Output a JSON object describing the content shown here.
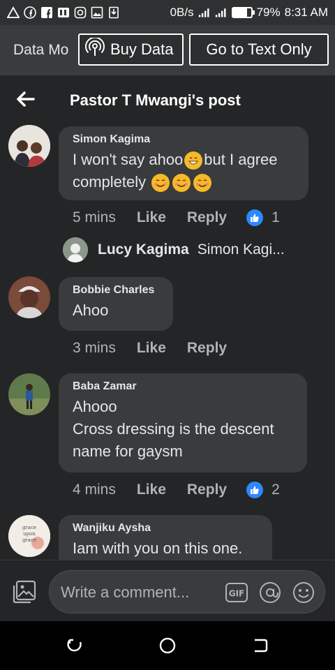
{
  "status_bar": {
    "speed": "0B/s",
    "battery": "79%",
    "battery_level": 0.79,
    "time": "8:31 AM"
  },
  "data_bar": {
    "mode_label": "Data Mo",
    "buy_label": "Buy Data",
    "text_only_label": "Go to Text Only"
  },
  "header": {
    "title": "Pastor T Mwangi's post"
  },
  "comments": [
    {
      "name": "Simon Kagima",
      "text_1": "I won't say ahoo",
      "text_2": "but I agree",
      "text_3": "completely",
      "time": "5 mins",
      "like": "Like",
      "reply": "Reply",
      "reactions": "1"
    },
    {
      "name": "Bobbie Charles",
      "text": "Ahoo",
      "time": "3 mins",
      "like": "Like",
      "reply": "Reply"
    },
    {
      "name": "Baba Zamar",
      "text_1": "Ahooo",
      "text_2": "Cross dressing is the descent",
      "text_3": "name for gaysm",
      "time": "4 mins",
      "like": "Like",
      "reply": "Reply",
      "reactions": "2"
    },
    {
      "name": "Wanjiku Aysha",
      "text": "Iam with you on this one."
    }
  ],
  "reply_preview": {
    "name": "Lucy Kagima",
    "snippet": "Simon Kagi..."
  },
  "composer": {
    "placeholder": "Write a comment..."
  },
  "avatar_logo": {
    "line_1": "grace",
    "line_2": "upon",
    "line_3": "grace"
  },
  "colors": {
    "background": "#242526",
    "bubble": "#3a3b3c",
    "like_blue": "#2d88ff"
  }
}
